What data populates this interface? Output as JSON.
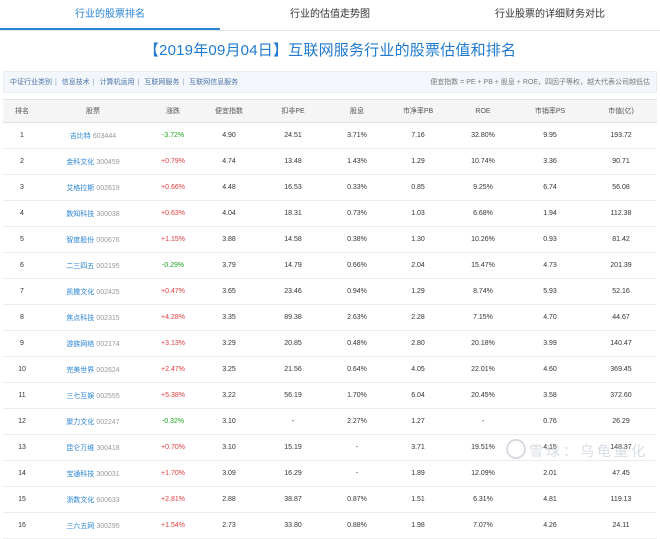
{
  "tabs": [
    {
      "label": "行业的股票排名"
    },
    {
      "label": "行业的估值走势图"
    },
    {
      "label": "行业股票的详细财务对比"
    }
  ],
  "title": "【2019年09月04日】互联网服务行业的股票估值和排名",
  "breadcrumbs": [
    "中证行业类别",
    "信息技术",
    "计算机运用",
    "互联网服务",
    "互联网信息服务"
  ],
  "formula": "便宜指数 = PE + PB + 股息 + ROE，四因子等权，越大代表公司越低估",
  "columns": [
    "排名",
    "股票",
    "涨跌",
    "便宜指数",
    "扣非PE",
    "股息",
    "市净率PB",
    "ROE",
    "市销率PS",
    "市值(亿)"
  ],
  "rows": [
    {
      "rank": "1",
      "name": "吉比特",
      "code": "603444",
      "change": "-3.72%",
      "cheap": "4.90",
      "pe": "24.51",
      "div": "3.71%",
      "pb": "7.16",
      "roe": "32.80%",
      "ps": "9.95",
      "cap": "193.72"
    },
    {
      "rank": "2",
      "name": "金科文化",
      "code": "300459",
      "change": "+0.79%",
      "cheap": "4.74",
      "pe": "13.48",
      "div": "1.43%",
      "pb": "1.29",
      "roe": "10.74%",
      "ps": "3.36",
      "cap": "90.71"
    },
    {
      "rank": "3",
      "name": "艾格拉斯",
      "code": "002619",
      "change": "+0.66%",
      "cheap": "4.48",
      "pe": "16.53",
      "div": "0.33%",
      "pb": "0.85",
      "roe": "9.25%",
      "ps": "6.74",
      "cap": "56.08"
    },
    {
      "rank": "4",
      "name": "数知科技",
      "code": "300038",
      "change": "+0.63%",
      "cheap": "4.04",
      "pe": "18.31",
      "div": "0.73%",
      "pb": "1.03",
      "roe": "6.68%",
      "ps": "1.94",
      "cap": "112.38"
    },
    {
      "rank": "5",
      "name": "智度股份",
      "code": "000676",
      "change": "+1.15%",
      "cheap": "3.88",
      "pe": "14.58",
      "div": "0.38%",
      "pb": "1.30",
      "roe": "10.26%",
      "ps": "0.93",
      "cap": "81.42"
    },
    {
      "rank": "6",
      "name": "二三四五",
      "code": "002195",
      "change": "-0.29%",
      "cheap": "3.79",
      "pe": "14.79",
      "div": "0.66%",
      "pb": "2.04",
      "roe": "15.47%",
      "ps": "4.73",
      "cap": "201.39"
    },
    {
      "rank": "7",
      "name": "凯撒文化",
      "code": "002425",
      "change": "+0.47%",
      "cheap": "3.65",
      "pe": "23.46",
      "div": "0.94%",
      "pb": "1.29",
      "roe": "8.74%",
      "ps": "5.93",
      "cap": "52.16"
    },
    {
      "rank": "8",
      "name": "焦点科技",
      "code": "002315",
      "change": "+4.28%",
      "cheap": "3.35",
      "pe": "89.38",
      "div": "2.63%",
      "pb": "2.28",
      "roe": "7.15%",
      "ps": "4.70",
      "cap": "44.67"
    },
    {
      "rank": "9",
      "name": "游族网络",
      "code": "002174",
      "change": "+3.13%",
      "cheap": "3.29",
      "pe": "20.85",
      "div": "0.48%",
      "pb": "2.80",
      "roe": "20.18%",
      "ps": "3.99",
      "cap": "140.47"
    },
    {
      "rank": "10",
      "name": "完美世界",
      "code": "002624",
      "change": "+2.47%",
      "cheap": "3.25",
      "pe": "21.56",
      "div": "0.64%",
      "pb": "4.05",
      "roe": "22.01%",
      "ps": "4.60",
      "cap": "369.45"
    },
    {
      "rank": "11",
      "name": "三七互娱",
      "code": "002555",
      "change": "+5.38%",
      "cheap": "3.22",
      "pe": "56.19",
      "div": "1.70%",
      "pb": "6.04",
      "roe": "20.45%",
      "ps": "3.58",
      "cap": "372.60"
    },
    {
      "rank": "12",
      "name": "聚力文化",
      "code": "002247",
      "change": "-0.32%",
      "cheap": "3.10",
      "pe": "-",
      "div": "2.27%",
      "pb": "1.27",
      "roe": "-",
      "ps": "0.76",
      "cap": "26.29"
    },
    {
      "rank": "13",
      "name": "昆仑万维",
      "code": "300418",
      "change": "+0.70%",
      "cheap": "3.10",
      "pe": "15.19",
      "div": "-",
      "pb": "3.71",
      "roe": "19.51%",
      "ps": "4.15",
      "cap": "148.37"
    },
    {
      "rank": "14",
      "name": "宝通科技",
      "code": "300031",
      "change": "+1.70%",
      "cheap": "3.09",
      "pe": "16.29",
      "div": "-",
      "pb": "1.89",
      "roe": "12.09%",
      "ps": "2.01",
      "cap": "47.45"
    },
    {
      "rank": "15",
      "name": "浙数文化",
      "code": "600633",
      "change": "+2.81%",
      "cheap": "2.88",
      "pe": "38.87",
      "div": "0.87%",
      "pb": "1.51",
      "roe": "6.31%",
      "ps": "4.81",
      "cap": "119.13"
    },
    {
      "rank": "16",
      "name": "三六五网",
      "code": "300295",
      "change": "+1.54%",
      "cheap": "2.73",
      "pe": "33.80",
      "div": "0.88%",
      "pb": "1.98",
      "roe": "7.07%",
      "ps": "4.26",
      "cap": "24.11"
    }
  ],
  "watermark": "雪球：乌龟量化"
}
